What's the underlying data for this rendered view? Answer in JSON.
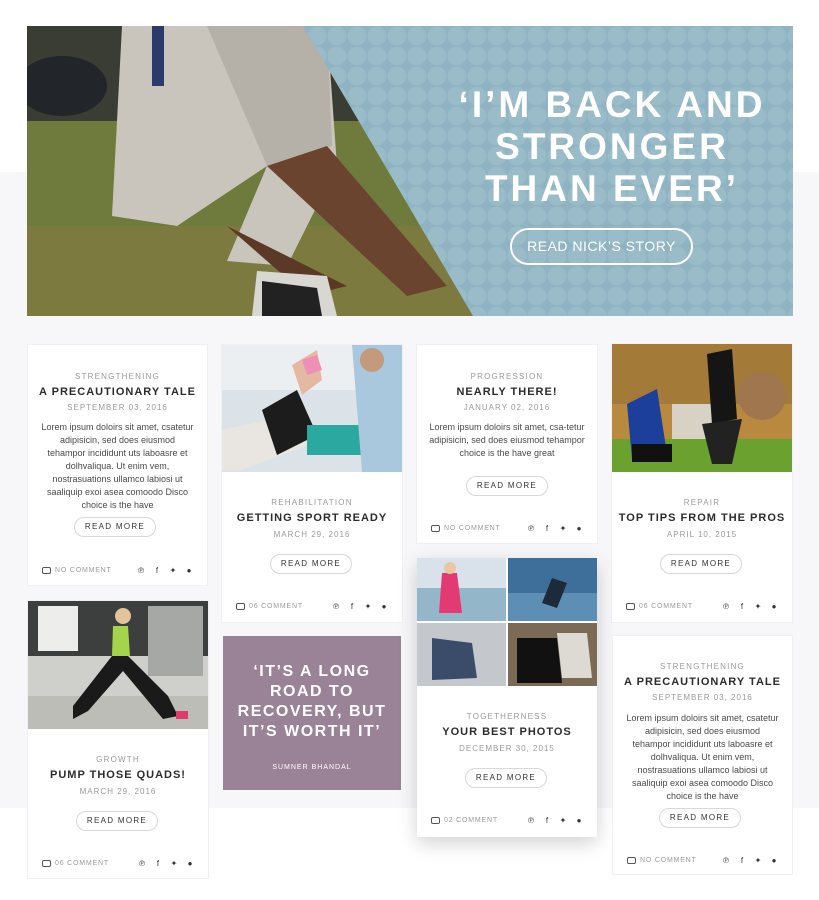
{
  "hero": {
    "quote": "‘I’M BACK AND\nSTRONGER\nTHAN EVER’",
    "button_label": "READ NICK’S STORY"
  },
  "cards": {
    "c1": {
      "category": "STRENGTHENING",
      "title": "A PRECAUTIONARY TALE",
      "date": "SEPTEMBER 03, 2016",
      "excerpt": "Lorem ipsum doloirs sit amet, csatetur adipisicin, sed does eiusmod tehampor incididunt uts laboasre et dolhvaliqua. Ut enim vem, nostrasuations ullamco labiosi ut saaliquip exoi asea comoodo Disco choice is the have",
      "comments": "NO COMMENT"
    },
    "c2": {
      "category": "REHABILITATION",
      "title": "GETTING SPORT READY",
      "date": "MARCH 29, 2016",
      "read_more": "READ MORE",
      "comments": "06 COMMENT"
    },
    "c3": {
      "category": "PROGRESSION",
      "title": "NEARLY THERE!",
      "date": "JANUARY 02, 2016",
      "excerpt": "Lorem ipsum doloirs sit amet, csa-tetur adipisicin, sed does eiusmod tehampor choice is the have great",
      "read_more": "READ MORE",
      "comments": "NO COMMENT"
    },
    "c4": {
      "category": "REPAIR",
      "title": "TOP TIPS FROM THE PROS",
      "date": "APRIL 10, 2015",
      "read_more": "READ MORE",
      "comments": "06 COMMENT"
    },
    "c5": {
      "category": "GROWTH",
      "title": "PUMP THOSE QUADS!",
      "date": "MARCH 29, 2016",
      "read_more": "READ MORE",
      "comments": "06 COMMENT"
    },
    "c6": {
      "quote": "‘IT’S A LONG\nROAD TO\nRECOVERY, BUT\nIT’S WORTH IT’",
      "author": "SUMNER BHANDAL"
    },
    "c7": {
      "category": "TOGETHERNESS",
      "title": "YOUR BEST PHOTOS",
      "date": "DECEMBER 30, 2015",
      "read_more": "READ MORE",
      "comments": "02 COMMENT"
    },
    "c8": {
      "category": "STRENGTHENING",
      "title": "A PRECAUTIONARY TALE",
      "date": "SEPTEMBER 03, 2016",
      "excerpt": "Lorem ipsum doloirs sit amet, csatetur adipisicin, sed does eiusmod tehampor incididunt uts laboasre et dolhvaliqua. Ut enim vem, nostrasuations ullamco labiosi ut saaliquip exoi asea comoodo Disco choice is the have",
      "read_more": "READ MORE",
      "comments": "NO COMMENT"
    }
  },
  "c1_read_more": "READ MORE",
  "social_icons": [
    "pinterest-icon",
    "facebook-icon",
    "twitter-icon",
    "pinterest-alt-icon"
  ],
  "colors": {
    "hero_panel": "#8fb3c2",
    "quote_card": "#9a8397",
    "accent_text": "#2c2c2c"
  }
}
